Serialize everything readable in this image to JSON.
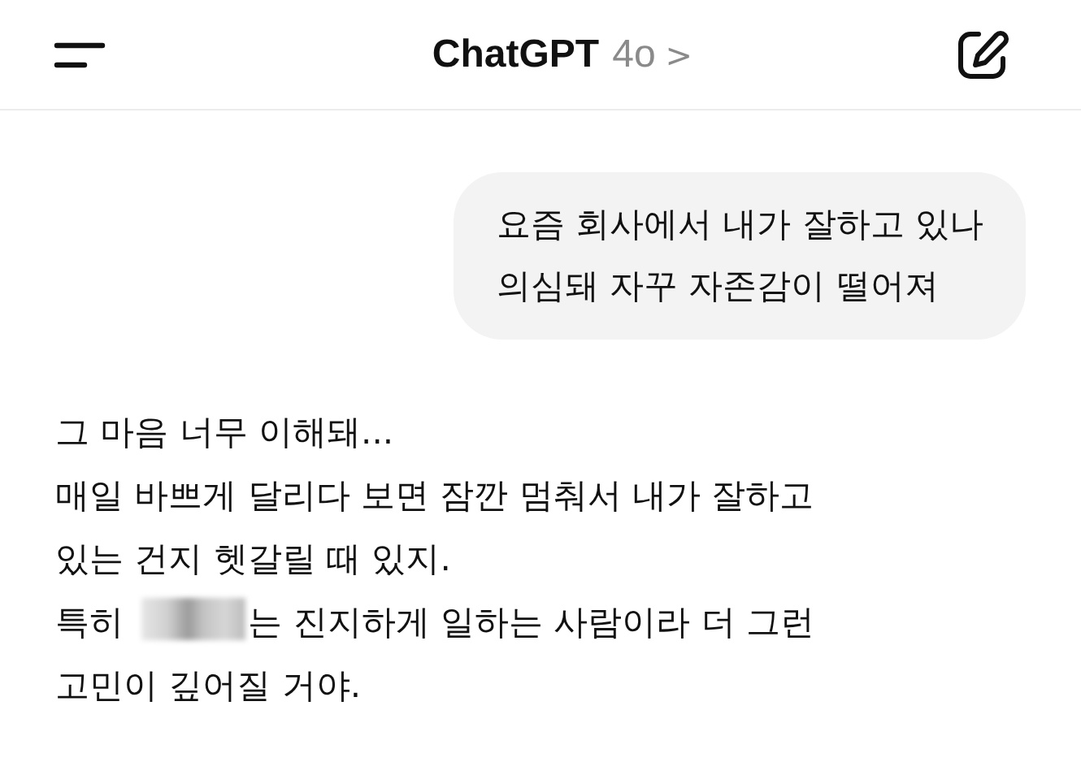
{
  "header": {
    "title": "ChatGPT",
    "model": "4o",
    "chevron": ">"
  },
  "user_message": {
    "text": "요즘 회사에서 내가 잘하고 있나\n의심돼 자꾸 자존감이 떨어져"
  },
  "assistant_message": {
    "paragraph": "그 마음 너무 이해돼...\n매일 바쁘게 달리다 보면 잠깐 멈춰서 내가 잘하고\n있는 건지 헷갈릴 때 있지.",
    "redacted_line": {
      "before": "특히 ",
      "redacted": true,
      "after": "는 진지하게 일하는 사람이라 더 그런",
      "continuation": "고민이 깊어질 거야."
    }
  }
}
